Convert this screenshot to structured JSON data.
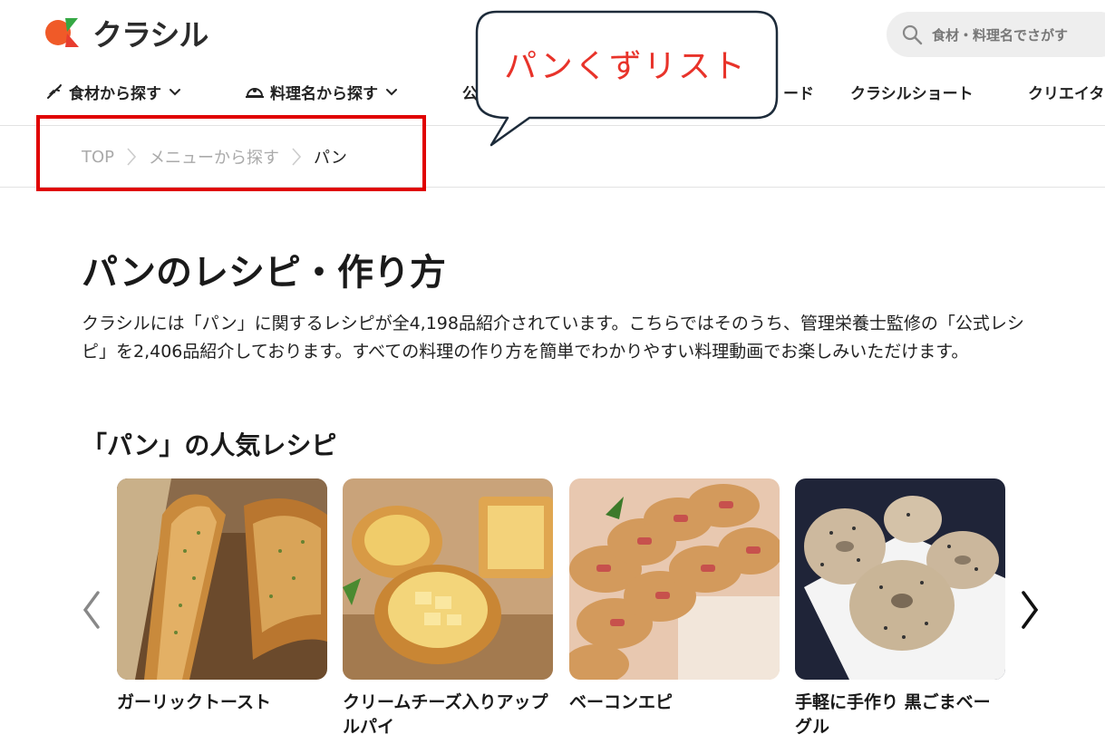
{
  "header": {
    "logo_text": "クラシル",
    "search_placeholder": "食材・料理名でさがす"
  },
  "nav": {
    "items": [
      {
        "label": "食材から探す"
      },
      {
        "label": "料理名から探す"
      },
      {
        "label": "公"
      },
      {
        "label": "ード"
      },
      {
        "label": "クラシルショート"
      },
      {
        "label": "クリエイタ"
      }
    ]
  },
  "breadcrumb": {
    "items": [
      "TOP",
      "メニューから探す",
      "パン"
    ]
  },
  "annotation": {
    "callout_text": "パンくずリスト",
    "colors": {
      "box": "#e00000",
      "callout_text": "#e8332a",
      "callout_border": "#1d2b3a"
    }
  },
  "main": {
    "title": "パンのレシピ・作り方",
    "intro": "クラシルには「パン」に関するレシピが全4,198品紹介されています。こちらではそのうち、管理栄養士監修の「公式レシピ」を2,406品紹介しております。すべての料理の作り方を簡単でわかりやすい料理動画でお楽しみいただけます。",
    "popular_title": "「パン」の人気レシピ",
    "recipes": [
      {
        "title": "ガーリックトースト"
      },
      {
        "title": "クリームチーズ入りアップルパイ"
      },
      {
        "title": "ベーコンエピ"
      },
      {
        "title": "手軽に手作り 黒ごまベーグル"
      }
    ]
  },
  "colors": {
    "brand_orange": "#f05a28",
    "brand_green": "#35a844",
    "brand_red": "#e83d2f"
  }
}
